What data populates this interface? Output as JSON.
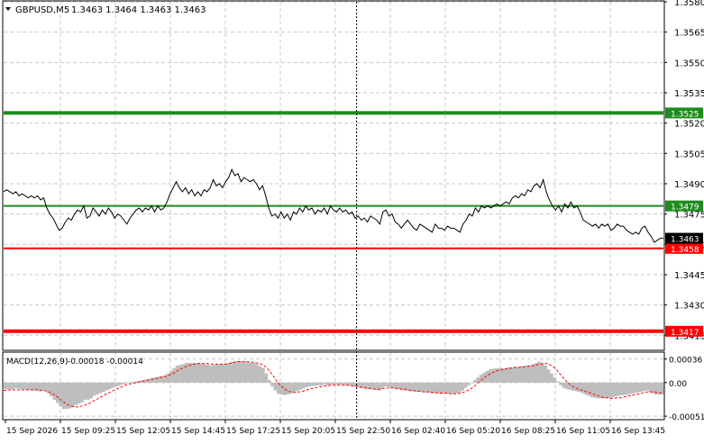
{
  "header": {
    "symbol": "GBPUSD,M5",
    "ohlc": "1.3463 1.3464 1.3463 1.3463"
  },
  "macd_header": {
    "label": "MACD(12,26,9)",
    "values": "-0.00018 -0.00014"
  },
  "colors": {
    "background": "#ffffff",
    "grid": "#c8c8c8",
    "axis": "#000000",
    "price_line": "#000000",
    "green_level": "#1e8c1e",
    "red_level": "#ff0000",
    "macd_hist": "#bebebe",
    "macd_signal": "#ff0000",
    "current_price_bg": "#000000",
    "label_text": "#ffffff"
  },
  "chart_data": [
    {
      "type": "line",
      "name_of_panel": "price",
      "symbol": "GBPUSD,M5",
      "ylim": [
        1.3408,
        1.358
      ],
      "y_ticks": [
        "1.3580",
        "1.3565",
        "1.3550",
        "1.3535",
        "1.3520",
        "1.3505",
        "1.3490",
        "1.3475",
        "1.3460",
        "1.3445",
        "1.3430",
        "1.3415"
      ],
      "grid": true,
      "series": [
        {
          "values": [
            1.3486,
            1.3487,
            1.3486,
            1.3485,
            1.3486,
            1.3484,
            1.3485,
            1.3484,
            1.3483,
            1.3484,
            1.3483,
            1.3484,
            1.3482,
            1.3483,
            1.3478,
            1.3475,
            1.3473,
            1.347,
            1.3467,
            1.3468,
            1.3471,
            1.3473,
            1.3472,
            1.3475,
            1.3477,
            1.3476,
            1.3479,
            1.3473,
            1.3474,
            1.3478,
            1.3476,
            1.3474,
            1.3477,
            1.3475,
            1.3478,
            1.3476,
            1.3473,
            1.3475,
            1.3474,
            1.3472,
            1.347,
            1.3473,
            1.3475,
            1.3477,
            1.3478,
            1.3476,
            1.3478,
            1.3477,
            1.3479,
            1.3476,
            1.3479,
            1.3477,
            1.3478,
            1.3481,
            1.3485,
            1.3488,
            1.3491,
            1.3488,
            1.3486,
            1.3488,
            1.3485,
            1.3487,
            1.3484,
            1.3486,
            1.3484,
            1.3487,
            1.3486,
            1.3488,
            1.3492,
            1.3489,
            1.349,
            1.3488,
            1.3491,
            1.3493,
            1.3497,
            1.3494,
            1.3495,
            1.3491,
            1.3493,
            1.3492,
            1.3491,
            1.3492,
            1.349,
            1.3487,
            1.3489,
            1.3484,
            1.3478,
            1.3474,
            1.3475,
            1.3473,
            1.3476,
            1.3473,
            1.3475,
            1.3472,
            1.3476,
            1.3475,
            1.3478,
            1.3476,
            1.3479,
            1.3477,
            1.3478,
            1.3475,
            1.3477,
            1.3476,
            1.3478,
            1.3475,
            1.3479,
            1.3477,
            1.3476,
            1.3478,
            1.3476,
            1.3477,
            1.3475,
            1.3476,
            1.3473,
            1.3474,
            1.3472,
            1.3473,
            1.3471,
            1.3474,
            1.3473,
            1.3472,
            1.347,
            1.3476,
            1.3477,
            1.3474,
            1.3475,
            1.3471,
            1.347,
            1.3468,
            1.347,
            1.3472,
            1.347,
            1.3468,
            1.3467,
            1.347,
            1.3469,
            1.3468,
            1.3467,
            1.3466,
            1.347,
            1.3468,
            1.3468,
            1.3467,
            1.3469,
            1.3468,
            1.3468,
            1.3467,
            1.3466,
            1.347,
            1.3472,
            1.3475,
            1.3474,
            1.3478,
            1.3476,
            1.3479,
            1.3478,
            1.3479,
            1.3478,
            1.3479,
            1.348,
            1.3479,
            1.348,
            1.3481,
            1.348,
            1.3483,
            1.3484,
            1.3483,
            1.3485,
            1.3484,
            1.3487,
            1.3486,
            1.3489,
            1.349,
            1.3488,
            1.3492,
            1.3486,
            1.3482,
            1.3479,
            1.3477,
            1.3479,
            1.3476,
            1.348,
            1.3478,
            1.3481,
            1.3478,
            1.3479,
            1.3476,
            1.3472,
            1.3471,
            1.347,
            1.3469,
            1.347,
            1.3468,
            1.347,
            1.3469,
            1.347,
            1.3467,
            1.3468,
            1.347,
            1.3469,
            1.3469,
            1.3467,
            1.3466,
            1.3465,
            1.3466,
            1.3465,
            1.3468,
            1.3469,
            1.3466,
            1.3464,
            1.3461,
            1.3462,
            1.3463,
            1.3463
          ]
        }
      ],
      "levels": [
        {
          "value": 1.3525,
          "label": "1.3525",
          "color": "#1e8c1e",
          "thick": true
        },
        {
          "value": 1.3479,
          "label": "1.3479",
          "color": "#1e8c1e",
          "thick": false
        },
        {
          "value": 1.3458,
          "label": "1.3458",
          "color": "#ff0000",
          "thick": false
        },
        {
          "value": 1.3417,
          "label": "1.3417",
          "color": "#ff0000",
          "thick": true
        }
      ],
      "current_price": {
        "value": 1.3463,
        "label": "1.3463"
      }
    },
    {
      "type": "bar",
      "name_of_panel": "macd",
      "title": "MACD(12,26,9)",
      "values_text": "-0.00018 -0.00014",
      "ylim": [
        -0.00055,
        0.00045
      ],
      "y_ticks": [
        "0.00036",
        "0.00",
        "-0.00051"
      ],
      "series": [
        {
          "kind": "histogram",
          "values": [
            -0.0001,
            -0.0001,
            -0.0001,
            -9e-05,
            -9e-05,
            -0.0001,
            -0.0001,
            -0.00011,
            -0.00011,
            -0.00012,
            -0.00012,
            -0.00013,
            -0.00012,
            -0.00012,
            -0.00016,
            -0.00021,
            -0.00026,
            -0.00031,
            -0.00036,
            -0.0004,
            -0.0004,
            -0.00039,
            -0.00037,
            -0.00034,
            -0.00032,
            -0.0003,
            -0.00026,
            -0.00026,
            -0.00024,
            -0.0002,
            -0.00018,
            -0.00016,
            -0.00014,
            -0.00012,
            -0.0001,
            -8e-05,
            -6e-05,
            -5e-05,
            -3e-05,
            -2e-05,
            -1e-05,
            0.0,
            1e-05,
            2e-05,
            3e-05,
            4e-05,
            5e-05,
            6e-05,
            7e-05,
            8e-05,
            9e-05,
            0.0001,
            0.00011,
            0.00014,
            0.00018,
            0.00022,
            0.00026,
            0.00027,
            0.00028,
            0.0003,
            0.0003,
            0.0003,
            0.0003,
            0.0003,
            0.00029,
            0.00028,
            0.00027,
            0.00026,
            0.00027,
            0.00028,
            0.00028,
            0.00028,
            0.00029,
            0.0003,
            0.00032,
            0.00032,
            0.00033,
            0.00032,
            0.00032,
            0.00031,
            0.0003,
            0.0003,
            0.00028,
            0.00025,
            0.00022,
            0.00014,
            4e-05,
            -6e-05,
            -0.00012,
            -0.00017,
            -0.00018,
            -0.00019,
            -0.00018,
            -0.00017,
            -0.00015,
            -0.00013,
            -0.00011,
            -9e-05,
            -7e-05,
            -6e-05,
            -5e-05,
            -5e-05,
            -4e-05,
            -4e-05,
            -3e-05,
            -4e-05,
            -3e-05,
            -3e-05,
            -3e-05,
            -3e-05,
            -3e-05,
            -4e-05,
            -4e-05,
            -5e-05,
            -6e-05,
            -7e-05,
            -8e-05,
            -9e-05,
            -0.0001,
            -0.0001,
            -0.0001,
            -0.00011,
            -0.00012,
            -8e-05,
            -6e-05,
            -7e-05,
            -8e-05,
            -9e-05,
            -0.0001,
            -0.00011,
            -0.00012,
            -0.00012,
            -0.00013,
            -0.00013,
            -0.00014,
            -0.00014,
            -0.00014,
            -0.00015,
            -0.00015,
            -0.00016,
            -0.00016,
            -0.00016,
            -0.00017,
            -0.00016,
            -0.00017,
            -0.00017,
            -0.00017,
            -0.00016,
            -0.00015,
            -0.00012,
            -8e-05,
            -4e-05,
            0.0,
            4e-05,
            8e-05,
            0.00012,
            0.00015,
            0.00018,
            0.0002,
            0.00021,
            0.00022,
            0.00022,
            0.00022,
            0.00022,
            0.00023,
            0.00023,
            0.00024,
            0.00024,
            0.00025,
            0.00025,
            0.00026,
            0.00026,
            0.00028,
            0.0003,
            0.00032,
            0.0003,
            0.00026,
            0.0002,
            0.00014,
            8e-05,
            2e-05,
            -4e-05,
            -8e-05,
            -0.0001,
            -0.00011,
            -0.00012,
            -0.00013,
            -0.00014,
            -0.00016,
            -0.00018,
            -0.0002,
            -0.00022,
            -0.00023,
            -0.00024,
            -0.00024,
            -0.00024,
            -0.00024,
            -0.00023,
            -0.00022,
            -0.00021,
            -0.0002,
            -0.00019,
            -0.00019,
            -0.00018,
            -0.00017,
            -0.00016,
            -0.00015,
            -0.00014,
            -0.00013,
            -0.00012,
            -0.00014,
            -0.00016,
            -0.00018,
            -0.00018,
            -0.00018
          ]
        },
        {
          "kind": "signal",
          "values": [
            -0.00012,
            -0.00012,
            -0.00011,
            -0.00011,
            -0.00011,
            -0.00011,
            -0.00011,
            -0.00011,
            -0.00011,
            -0.00011,
            -0.00011,
            -0.00011,
            -0.00012,
            -0.00012,
            -0.00013,
            -0.00015,
            -0.00017,
            -0.0002,
            -0.00024,
            -0.00028,
            -0.00031,
            -0.00034,
            -0.00036,
            -0.00037,
            -0.00037,
            -0.00036,
            -0.00035,
            -0.00033,
            -0.00031,
            -0.00028,
            -0.00026,
            -0.00023,
            -0.00021,
            -0.00018,
            -0.00016,
            -0.00013,
            -0.00011,
            -9e-05,
            -7e-05,
            -5e-05,
            -3e-05,
            -2e-05,
            -1e-05,
            0.0,
            1e-05,
            2e-05,
            3e-05,
            4e-05,
            5e-05,
            6e-05,
            7e-05,
            8e-05,
            9e-05,
            0.0001,
            0.00012,
            0.00014,
            0.00017,
            0.0002,
            0.00022,
            0.00024,
            0.00026,
            0.00027,
            0.00028,
            0.00029,
            0.00029,
            0.00029,
            0.00029,
            0.00028,
            0.00028,
            0.00028,
            0.00028,
            0.00028,
            0.00028,
            0.00029,
            0.0003,
            0.00031,
            0.00032,
            0.00032,
            0.00032,
            0.00032,
            0.00031,
            0.00031,
            0.0003,
            0.00029,
            0.00027,
            0.00024,
            0.00019,
            0.00013,
            6e-05,
            0.0,
            -5e-05,
            -9e-05,
            -0.00012,
            -0.00014,
            -0.00015,
            -0.00015,
            -0.00014,
            -0.00013,
            -0.00012,
            -0.0001,
            -9e-05,
            -8e-05,
            -7e-05,
            -6e-05,
            -5e-05,
            -5e-05,
            -4e-05,
            -4e-05,
            -4e-05,
            -4e-05,
            -4e-05,
            -4e-05,
            -4e-05,
            -5e-05,
            -5e-05,
            -6e-05,
            -7e-05,
            -8e-05,
            -8e-05,
            -9e-05,
            -0.0001,
            -0.0001,
            -0.0001,
            -9e-05,
            -9e-05,
            -8e-05,
            -8e-05,
            -9e-05,
            -9e-05,
            -0.0001,
            -0.0001,
            -0.00011,
            -0.00012,
            -0.00012,
            -0.00013,
            -0.00013,
            -0.00014,
            -0.00014,
            -0.00014,
            -0.00015,
            -0.00015,
            -0.00016,
            -0.00016,
            -0.00016,
            -0.00016,
            -0.00017,
            -0.00017,
            -0.00017,
            -0.00016,
            -0.00015,
            -0.00013,
            -0.00011,
            -8e-05,
            -4e-05,
            0.0,
            4e-05,
            8e-05,
            0.00011,
            0.00014,
            0.00016,
            0.00018,
            0.00019,
            0.0002,
            0.00021,
            0.00022,
            0.00022,
            0.00023,
            0.00023,
            0.00024,
            0.00024,
            0.00025,
            0.00025,
            0.00026,
            0.00027,
            0.00028,
            0.00029,
            0.00029,
            0.00028,
            0.00025,
            0.00021,
            0.00016,
            0.0001,
            5e-05,
            0.0,
            -4e-05,
            -7e-05,
            -9e-05,
            -0.00011,
            -0.00012,
            -0.00014,
            -0.00015,
            -0.00017,
            -0.00019,
            -0.0002,
            -0.00022,
            -0.00023,
            -0.00023,
            -0.00024,
            -0.00024,
            -0.00023,
            -0.00023,
            -0.00022,
            -0.00021,
            -0.0002,
            -0.00019,
            -0.00018,
            -0.00017,
            -0.00016,
            -0.00015,
            -0.00014,
            -0.00014,
            -0.00014,
            -0.00015,
            -0.00016,
            -0.00014
          ]
        }
      ]
    },
    {
      "type": "table",
      "name_of_panel": "time-axis",
      "x_ticks": [
        "15 Sep 2026",
        "15 Sep 09:25",
        "15 Sep 12:05",
        "15 Sep 14:45",
        "15 Sep 17:25",
        "15 Sep 20:05",
        "15 Sep 22:50",
        "16 Sep 02:40",
        "16 Sep 05:20",
        "16 Sep 08:25",
        "16 Sep 11:05",
        "16 Sep 13:45"
      ],
      "crosshair_index": 0.535
    }
  ]
}
